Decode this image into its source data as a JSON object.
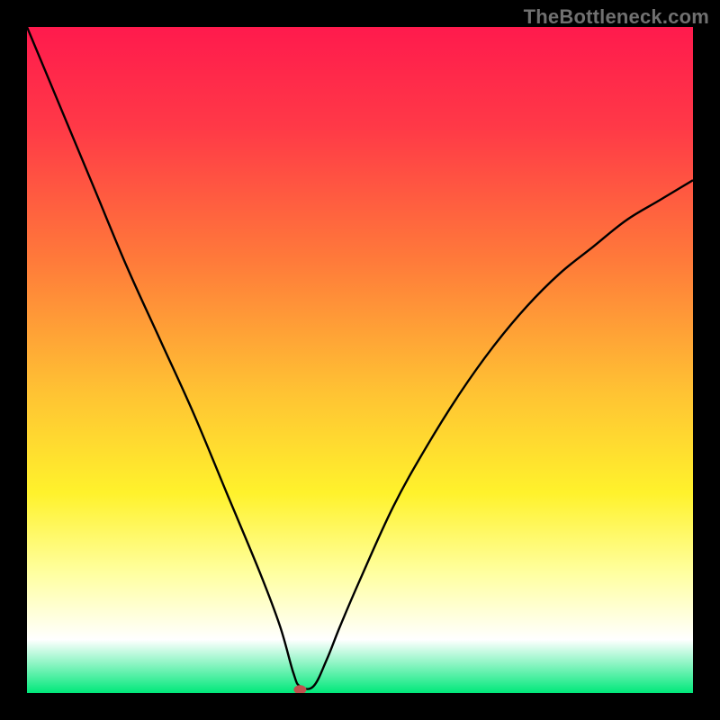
{
  "watermark": "TheBottleneck.com",
  "chart_data": {
    "type": "line",
    "title": "",
    "xlabel": "",
    "ylabel": "",
    "xlim": [
      0,
      100
    ],
    "ylim": [
      0,
      100
    ],
    "grid": false,
    "legend": false,
    "background": {
      "gradient_stops": [
        {
          "pos": 0,
          "color": "#ff1a4d"
        },
        {
          "pos": 15,
          "color": "#ff3947"
        },
        {
          "pos": 35,
          "color": "#ff7a3a"
        },
        {
          "pos": 55,
          "color": "#ffc333"
        },
        {
          "pos": 70,
          "color": "#fff22c"
        },
        {
          "pos": 82,
          "color": "#ffffa0"
        },
        {
          "pos": 92,
          "color": "#ffffff"
        },
        {
          "pos": 100,
          "color": "#00e87a"
        }
      ]
    },
    "marker": {
      "x": 41,
      "y": 0.5,
      "color": "#c0504d"
    },
    "series": [
      {
        "name": "curve",
        "color": "#000000",
        "x": [
          0,
          5,
          10,
          15,
          20,
          25,
          30,
          35,
          38,
          40,
          41,
          43,
          45,
          47,
          50,
          55,
          60,
          65,
          70,
          75,
          80,
          85,
          90,
          95,
          100
        ],
        "values": [
          100,
          88,
          76,
          64,
          53,
          42,
          30,
          18,
          10,
          3,
          1,
          1,
          5,
          10,
          17,
          28,
          37,
          45,
          52,
          58,
          63,
          67,
          71,
          74,
          77
        ]
      }
    ]
  }
}
